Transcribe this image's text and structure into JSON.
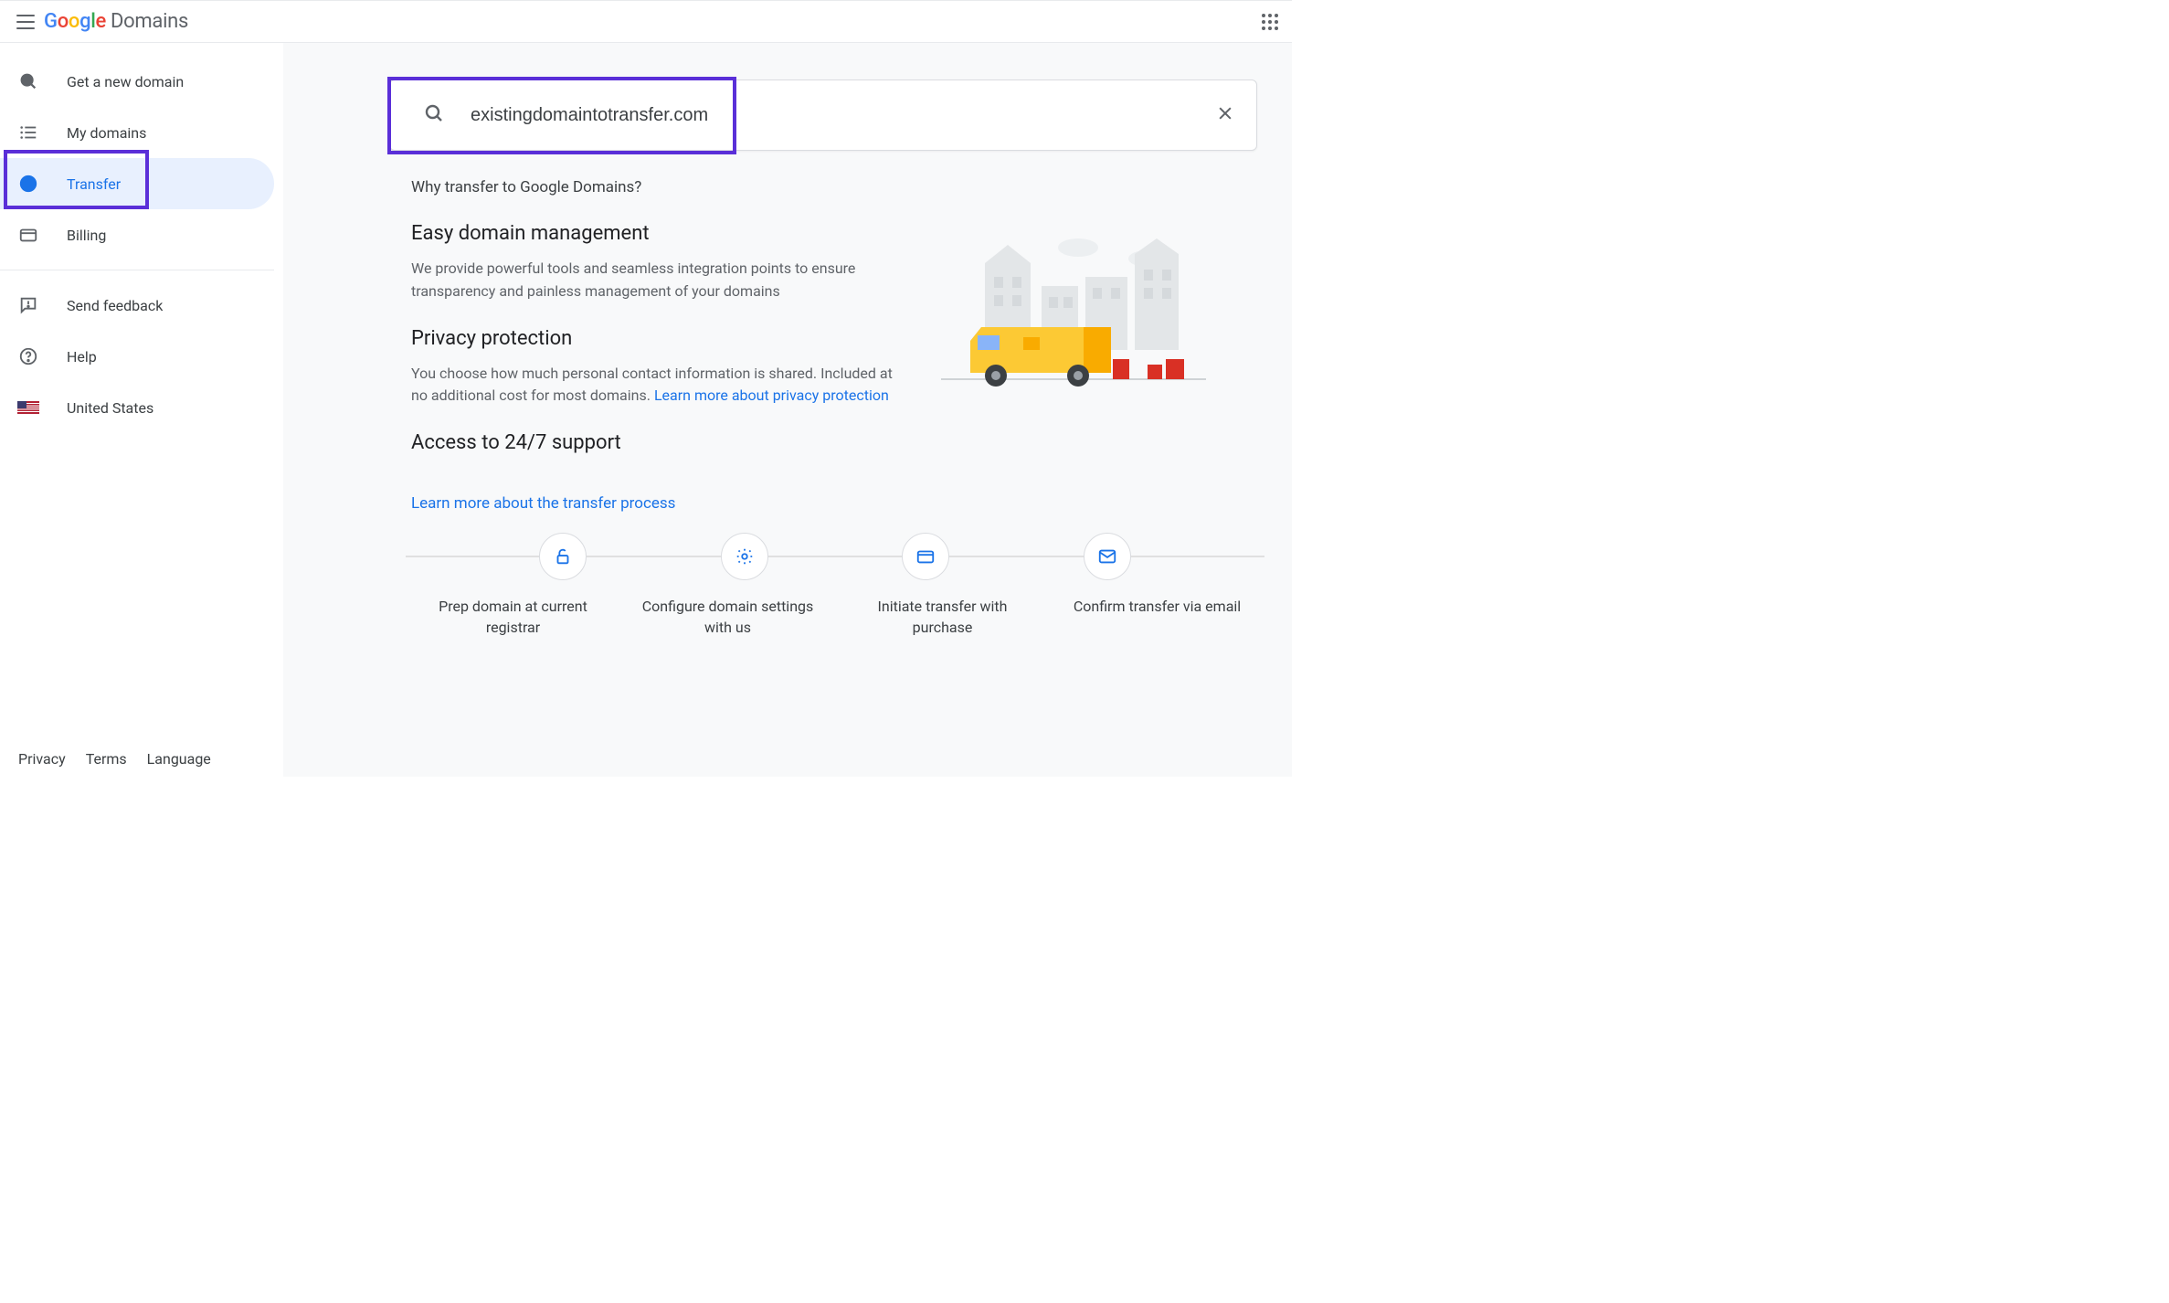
{
  "header": {
    "product_name_parts": [
      "G",
      "o",
      "o",
      "g",
      "l",
      "e"
    ],
    "product_suffix": "Domains"
  },
  "sidebar": {
    "items": [
      {
        "id": "get-domain",
        "label": "Get a new domain",
        "icon": "search-icon"
      },
      {
        "id": "my-domains",
        "label": "My domains",
        "icon": "list-icon"
      },
      {
        "id": "transfer",
        "label": "Transfer",
        "icon": "transfer-icon",
        "active": true
      },
      {
        "id": "billing",
        "label": "Billing",
        "icon": "credit-card-icon"
      }
    ],
    "secondary": [
      {
        "id": "send-feedback",
        "label": "Send feedback",
        "icon": "feedback-icon"
      },
      {
        "id": "help",
        "label": "Help",
        "icon": "help-icon"
      },
      {
        "id": "country",
        "label": "United States",
        "icon": "flag-us-icon"
      }
    ]
  },
  "footer": {
    "privacy": "Privacy",
    "terms": "Terms",
    "language": "Language"
  },
  "search": {
    "value": "existingdomaintotransfer.com",
    "placeholder": ""
  },
  "main": {
    "why_title": "Why transfer to Google Domains?",
    "features": [
      {
        "title": "Easy domain management",
        "body": "We provide powerful tools and seamless integration points to ensure transparency and painless management of your domains"
      },
      {
        "title": "Privacy protection",
        "body_prefix": "You choose how much personal contact information is shared. Included at no additional cost for most domains. ",
        "link_text": "Learn more about privacy protection"
      },
      {
        "title": "Access to 24/7 support",
        "body": ""
      }
    ],
    "learn_link": "Learn more about the transfer process",
    "steps": [
      {
        "label": "Prep domain at current registrar",
        "icon": "unlock-icon"
      },
      {
        "label": "Configure domain settings with us",
        "icon": "gear-icon"
      },
      {
        "label": "Initiate transfer with purchase",
        "icon": "credit-card-icon"
      },
      {
        "label": "Confirm transfer via email",
        "icon": "mail-icon"
      }
    ]
  }
}
